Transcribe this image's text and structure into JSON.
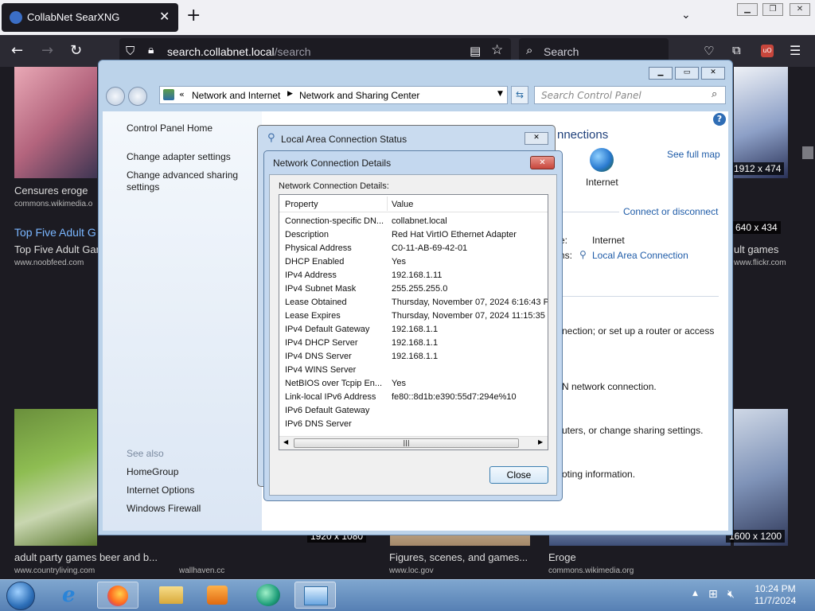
{
  "browser": {
    "tab_title": "CollabNet SearXNG",
    "url_host": "search.collabnet.local",
    "url_path": "/search",
    "search_placeholder": "Search"
  },
  "web": {
    "results": [
      {
        "caption": "Censures eroge",
        "source": "commons.wikimedia.o"
      },
      {
        "caption": "Top Five Adult G",
        "source": ""
      },
      {
        "caption": "Top Five Adult Gar",
        "source": "www.noobfeed.com"
      },
      {
        "caption": "ult games",
        "source": "www.flickr.com"
      },
      {
        "caption": "adult party games beer and b...",
        "source": "www.countryliving.com"
      },
      {
        "caption": "",
        "source": "wallhaven.cc"
      },
      {
        "caption": "Figures, scenes, and games...",
        "source": "www.loc.gov"
      },
      {
        "caption": "Eroge",
        "source": "commons.wikimedia.org"
      }
    ],
    "dims": [
      "1912 x 474",
      "640 x 434",
      "1920 x 1080",
      "1600 x 1200"
    ]
  },
  "control_panel": {
    "breadcrumb": [
      "Network and Internet",
      "Network and Sharing Center"
    ],
    "search_placeholder": "Search Control Panel",
    "sidebar": {
      "home": "Control Panel Home",
      "adapter": "Change adapter settings",
      "sharing": "Change advanced sharing settings",
      "see_also": "See also",
      "links": [
        "HomeGroup",
        "Internet Options",
        "Windows Firewall"
      ]
    },
    "main": {
      "connections_heading": "nnections",
      "see_full_map": "See full map",
      "internet_label": "Internet",
      "connect_or_disconnect": "Connect or disconnect",
      "access_type_label": "e:",
      "access_type_value": "Internet",
      "connections_label": "ns:",
      "connection_link": "Local Area Connection",
      "text1": "nection; or set up a router or access",
      "text2": "N network connection.",
      "text3": "uters, or change sharing settings.",
      "text4": "oting information."
    }
  },
  "lac_dialog": {
    "title": "Local Area Connection Status"
  },
  "details_dialog": {
    "title": "Network Connection Details",
    "heading": "Network Connection Details:",
    "col_property": "Property",
    "col_value": "Value",
    "rows": [
      {
        "p": "Connection-specific DN...",
        "v": "collabnet.local"
      },
      {
        "p": "Description",
        "v": "Red Hat VirtIO Ethernet Adapter"
      },
      {
        "p": "Physical Address",
        "v": "C0-11-AB-69-42-01"
      },
      {
        "p": "DHCP Enabled",
        "v": "Yes"
      },
      {
        "p": "IPv4 Address",
        "v": "192.168.1.11"
      },
      {
        "p": "IPv4 Subnet Mask",
        "v": "255.255.255.0"
      },
      {
        "p": "Lease Obtained",
        "v": "Thursday, November 07, 2024 6:16:43 PI"
      },
      {
        "p": "Lease Expires",
        "v": "Thursday, November 07, 2024 11:15:35 F"
      },
      {
        "p": "IPv4 Default Gateway",
        "v": "192.168.1.1"
      },
      {
        "p": "IPv4 DHCP Server",
        "v": "192.168.1.1"
      },
      {
        "p": "IPv4 DNS Server",
        "v": "192.168.1.1"
      },
      {
        "p": "IPv4 WINS Server",
        "v": ""
      },
      {
        "p": "NetBIOS over Tcpip En...",
        "v": "Yes"
      },
      {
        "p": "Link-local IPv6 Address",
        "v": "fe80::8d1b:e390:55d7:294e%10"
      },
      {
        "p": "IPv6 Default Gateway",
        "v": ""
      },
      {
        "p": "IPv6 DNS Server",
        "v": ""
      }
    ],
    "close_label": "Close"
  },
  "taskbar": {
    "time": "10:24 PM",
    "date": "11/7/2024"
  },
  "colors": {
    "accent": "#1f5ca8",
    "close_red": "#c7463c"
  }
}
